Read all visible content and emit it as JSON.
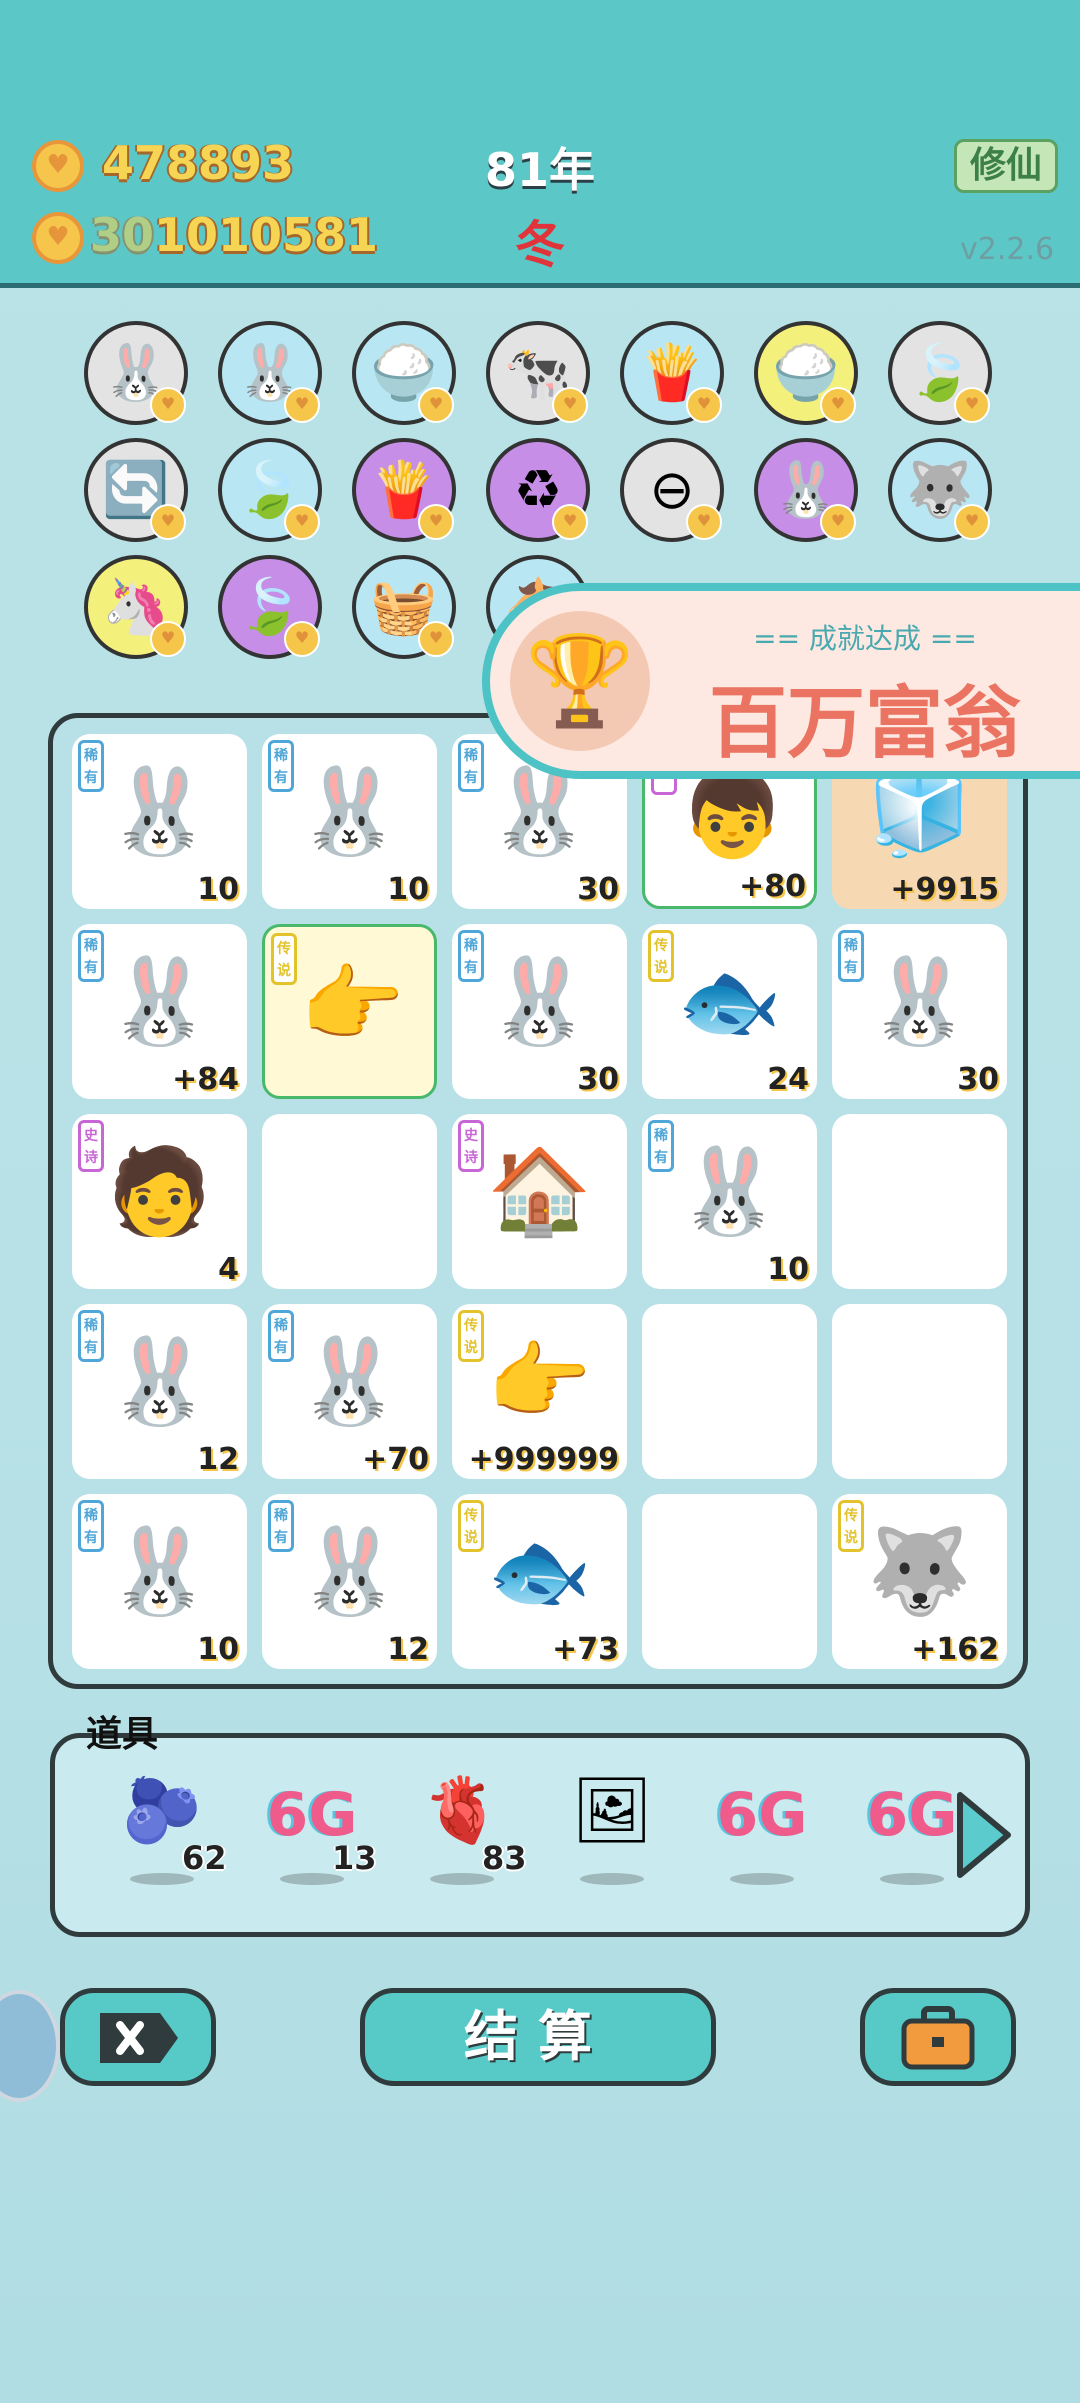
{
  "header": {
    "coins": "478893",
    "gems": "1010581",
    "gems_prefix": "30",
    "year": "81年",
    "season": "冬",
    "cultivate_button": "修仙",
    "version": "v2.2.6"
  },
  "tokens": [
    {
      "icon": "rabbit-icon",
      "glyph": "🐰",
      "bg": "#e3e3e3"
    },
    {
      "icon": "rabbit-icon",
      "glyph": "🐰",
      "bg": "#b8e6f2"
    },
    {
      "icon": "rice-bowl-icon",
      "glyph": "🍚",
      "bg": "#b8e6f2"
    },
    {
      "icon": "cow-icon",
      "glyph": "🐄",
      "bg": "#e3e3e3"
    },
    {
      "icon": "fries-icon",
      "glyph": "🍟",
      "bg": "#b8e6f2"
    },
    {
      "icon": "rice-bowl-icon",
      "glyph": "🍚",
      "bg": "#f4f07c"
    },
    {
      "icon": "leaf-icon",
      "glyph": "🍃",
      "bg": "#e3e3e3"
    },
    {
      "icon": "refresh-icon",
      "glyph": "🔄",
      "bg": "#e3e3e3"
    },
    {
      "icon": "leaf-icon",
      "glyph": "🍃",
      "bg": "#b8e6f2"
    },
    {
      "icon": "fries-icon",
      "glyph": "🍟",
      "bg": "#c78ee8"
    },
    {
      "icon": "recycle-icon",
      "glyph": "♻",
      "bg": "#c78ee8"
    },
    {
      "icon": "remove-icon",
      "glyph": "⊖",
      "bg": "#e3e3e3"
    },
    {
      "icon": "rabbit-icon",
      "glyph": "🐰",
      "bg": "#c78ee8"
    },
    {
      "icon": "husky-icon",
      "glyph": "🐺",
      "bg": "#b8e6f2"
    },
    {
      "icon": "unicorn-icon",
      "glyph": "🦄",
      "bg": "#f4f07c"
    },
    {
      "icon": "leaf-icon",
      "glyph": "🍃",
      "bg": "#c78ee8"
    },
    {
      "icon": "fruit-basket-icon",
      "glyph": "🧺",
      "bg": "#b8e6f2"
    },
    {
      "icon": "horse-icon",
      "glyph": "🐴",
      "bg": "#b8e6f2"
    }
  ],
  "toast": {
    "subtitle": "== 成就达成 ==",
    "title": "百万富翁"
  },
  "board": [
    {
      "icon": "rabbit-icon",
      "glyph": "🐰",
      "tag": "稀有",
      "tagc": "#4fa6d8",
      "num": "10"
    },
    {
      "icon": "rabbit-icon",
      "glyph": "🐰",
      "tag": "稀有",
      "tagc": "#4fa6d8",
      "num": "10"
    },
    {
      "icon": "rabbit-icon",
      "glyph": "🐰",
      "tag": "稀有",
      "tagc": "#4fa6d8",
      "num": "30"
    },
    {
      "icon": "chef-boy-icon",
      "glyph": "👦",
      "tag": "诗",
      "tagc": "#c766d4",
      "num": "+80",
      "hl": "green"
    },
    {
      "icon": "fridge-icon",
      "glyph": "🧊",
      "tag": "",
      "tagc": "",
      "num": "+9915",
      "hl": "orange"
    },
    {
      "icon": "rabbit-icon",
      "glyph": "🐰",
      "tag": "稀有",
      "tagc": "#4fa6d8",
      "num": "+84"
    },
    {
      "icon": "crowned-hand-icon",
      "glyph": "👉",
      "tag": "传说",
      "tagc": "#e3c32b",
      "num": "",
      "hl": "gold"
    },
    {
      "icon": "rabbit-icon",
      "glyph": "🐰",
      "tag": "稀有",
      "tagc": "#4fa6d8",
      "num": "30"
    },
    {
      "icon": "koi-fish-icon",
      "glyph": "🐟",
      "tag": "传说",
      "tagc": "#e3c32b",
      "num": "24"
    },
    {
      "icon": "rabbit-icon",
      "glyph": "🐰",
      "tag": "稀有",
      "tagc": "#4fa6d8",
      "num": "30"
    },
    {
      "icon": "hair-guy-icon",
      "glyph": "🧑",
      "tag": "史诗",
      "tagc": "#c766d4",
      "num": "4"
    },
    {
      "icon": "",
      "glyph": "",
      "tag": "",
      "tagc": "",
      "num": ""
    },
    {
      "icon": "rabbit-house-icon",
      "glyph": "🏠",
      "tag": "史诗",
      "tagc": "#c766d4",
      "num": ""
    },
    {
      "icon": "rabbit-icon",
      "glyph": "🐰",
      "tag": "稀有",
      "tagc": "#4fa6d8",
      "num": "10"
    },
    {
      "icon": "",
      "glyph": "",
      "tag": "",
      "tagc": "",
      "num": ""
    },
    {
      "icon": "rabbit-icon",
      "glyph": "🐰",
      "tag": "稀有",
      "tagc": "#4fa6d8",
      "num": "12"
    },
    {
      "icon": "rabbit-icon",
      "glyph": "🐰",
      "tag": "稀有",
      "tagc": "#4fa6d8",
      "num": "+70"
    },
    {
      "icon": "pointing-hand-icon",
      "glyph": "👉",
      "tag": "传说",
      "tagc": "#e3c32b",
      "num": "+999999"
    },
    {
      "icon": "",
      "glyph": "",
      "tag": "",
      "tagc": "",
      "num": ""
    },
    {
      "icon": "",
      "glyph": "",
      "tag": "",
      "tagc": "",
      "num": ""
    },
    {
      "icon": "rabbit-icon",
      "glyph": "🐰",
      "tag": "稀有",
      "tagc": "#4fa6d8",
      "num": "10"
    },
    {
      "icon": "rabbit-icon",
      "glyph": "🐰",
      "tag": "稀有",
      "tagc": "#4fa6d8",
      "num": "12"
    },
    {
      "icon": "koi-fish-icon",
      "glyph": "🐟",
      "tag": "传说",
      "tagc": "#e3c32b",
      "num": "+73"
    },
    {
      "icon": "",
      "glyph": "",
      "tag": "",
      "tagc": "",
      "num": ""
    },
    {
      "icon": "crowned-husky-icon",
      "glyph": "🐺",
      "tag": "传说",
      "tagc": "#e3c32b",
      "num": "+162"
    }
  ],
  "items": {
    "label": "道具",
    "list": [
      {
        "icon": "blueberry-icon",
        "glyph": "🫐",
        "count": "62"
      },
      {
        "icon": "6g-icon",
        "glyph": "6G",
        "count": "13"
      },
      {
        "icon": "liver-icon",
        "glyph": "🫀",
        "count": "83"
      },
      {
        "icon": "rabbit-poster-icon",
        "glyph": "🖼",
        "count": ""
      },
      {
        "icon": "6g-icon",
        "glyph": "6G",
        "count": ""
      },
      {
        "icon": "6g-icon",
        "glyph": "6G",
        "count": ""
      }
    ]
  },
  "buttons": {
    "settle": "结算"
  }
}
